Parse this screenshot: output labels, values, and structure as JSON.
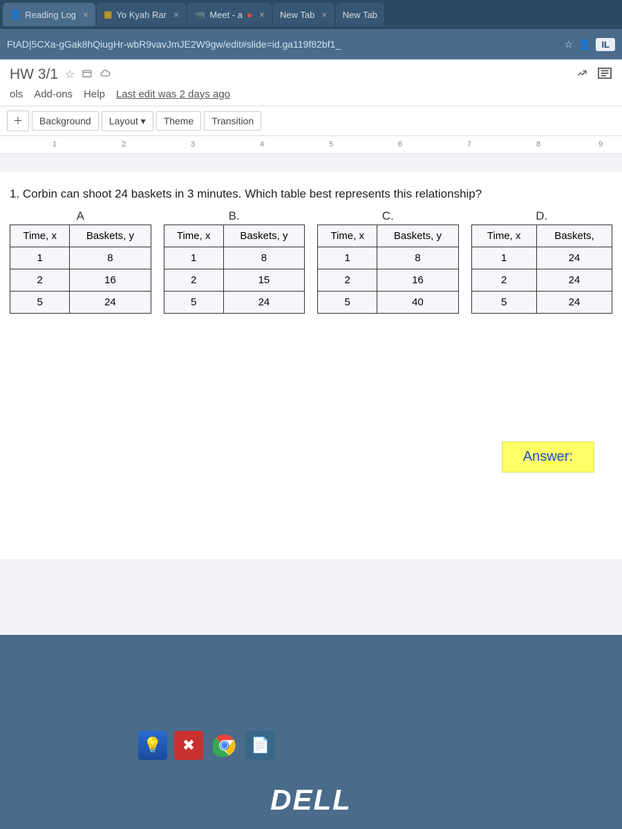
{
  "tabs": [
    {
      "label": "Reading Log"
    },
    {
      "label": "Yo Kyah Rar"
    },
    {
      "label": "Meet - a"
    },
    {
      "label": "New Tab"
    },
    {
      "label": "New Tab"
    }
  ],
  "address_bar": {
    "url": "FtAD|5CXa-gGak8hQiugHr-wbR9vavJmJE2W9gw/edit#slide=id.ga119f82bf1_",
    "star": "☆",
    "extension": "IL"
  },
  "doc": {
    "title": "HW 3/1",
    "star": "☆"
  },
  "menu": {
    "items": [
      "ols",
      "Add-ons",
      "Help"
    ],
    "last_edit": "Last edit was 2 days ago"
  },
  "toolbar": {
    "plus": "＋",
    "background": "Background",
    "layout": "Layout",
    "theme": "Theme",
    "transition": "Transition"
  },
  "ruler": [
    "1",
    "2",
    "3",
    "4",
    "5",
    "6",
    "7",
    "8",
    "9"
  ],
  "slide": {
    "question": "1. Corbin can shoot 24 baskets in 3 minutes. Which table best represents this relationship?",
    "tables": [
      {
        "label": "A",
        "headers": [
          "Time, x",
          "Baskets, y"
        ],
        "rows": [
          [
            "1",
            "8"
          ],
          [
            "2",
            "16"
          ],
          [
            "5",
            "24"
          ]
        ]
      },
      {
        "label": "B.",
        "headers": [
          "Time, x",
          "Baskets, y"
        ],
        "rows": [
          [
            "1",
            "8"
          ],
          [
            "2",
            "15"
          ],
          [
            "5",
            "24"
          ]
        ]
      },
      {
        "label": "C.",
        "headers": [
          "Time, x",
          "Baskets, y"
        ],
        "rows": [
          [
            "1",
            "8"
          ],
          [
            "2",
            "16"
          ],
          [
            "5",
            "40"
          ]
        ]
      },
      {
        "label": "D.",
        "headers": [
          "Time, x",
          "Baskets,"
        ],
        "rows": [
          [
            "1",
            "24"
          ],
          [
            "2",
            "24"
          ],
          [
            "5",
            "24"
          ]
        ]
      }
    ],
    "answer_label": "Answer:"
  },
  "dell": "DELL",
  "chart_data": {
    "type": "table",
    "title": "Corbin can shoot 24 baskets in 3 minutes. Which table best represents this relationship?",
    "options": {
      "A": {
        "Time_x": [
          1,
          2,
          5
        ],
        "Baskets_y": [
          8,
          16,
          24
        ]
      },
      "B": {
        "Time_x": [
          1,
          2,
          5
        ],
        "Baskets_y": [
          8,
          15,
          24
        ]
      },
      "C": {
        "Time_x": [
          1,
          2,
          5
        ],
        "Baskets_y": [
          8,
          16,
          40
        ]
      },
      "D": {
        "Time_x": [
          1,
          2,
          5
        ],
        "Baskets_y": [
          24,
          24,
          24
        ]
      }
    }
  }
}
